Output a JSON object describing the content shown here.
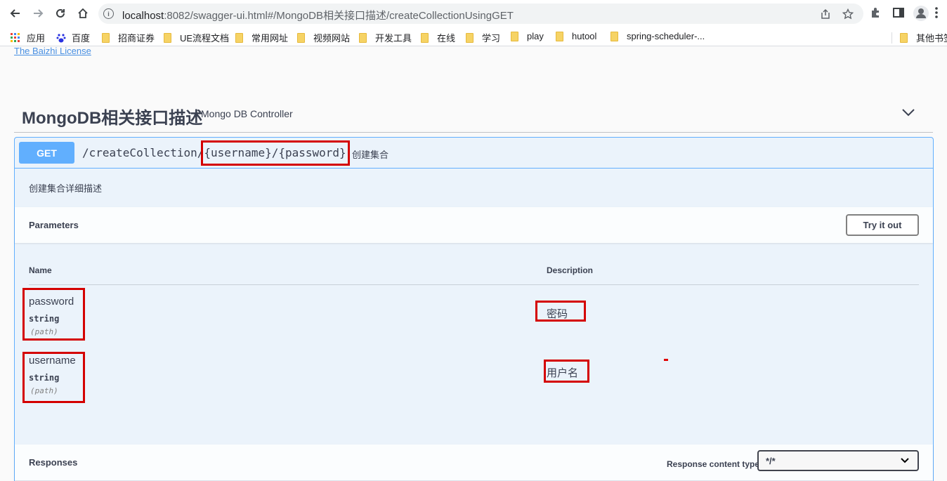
{
  "browser": {
    "url_host": "localhost",
    "url_rest": ":8082/swagger-ui.html#/MongoDB相关接口描述/createCollectionUsingGET",
    "bookmarks": [
      "应用",
      "百度",
      "招商证券",
      "UE流程文档",
      "常用网址",
      "视频网站",
      "开发工具",
      "在线",
      "学习",
      "play",
      "hutool",
      "spring-scheduler-...",
      "其他书签"
    ]
  },
  "page": {
    "license_link": "The Baizhi License"
  },
  "tag": {
    "title": "MongoDB相关接口描述",
    "description": "Mongo DB Controller"
  },
  "operation": {
    "method": "GET",
    "path_prefix": "/createCollection/",
    "path_params": "{username}/{password}",
    "summary": "创建集合",
    "description": "创建集合详细描述",
    "parameters_title": "Parameters",
    "try_it_out": "Try it out",
    "columns": {
      "name": "Name",
      "description": "Description"
    },
    "params": [
      {
        "name": "password",
        "type": "string",
        "in": "(path)",
        "description": "密码"
      },
      {
        "name": "username",
        "type": "string",
        "in": "(path)",
        "description": "用户名"
      }
    ],
    "responses_title": "Responses",
    "response_content_type_label": "Response content type",
    "response_content_type_value": "*/*"
  },
  "colors": {
    "get_accent": "#61affe",
    "highlight_box": "#d40000"
  }
}
